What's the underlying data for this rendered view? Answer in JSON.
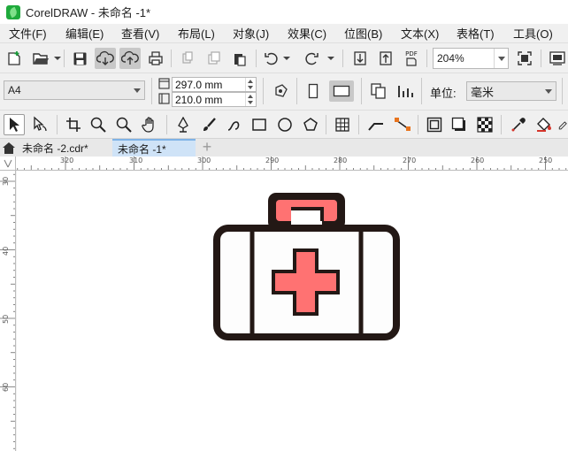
{
  "window": {
    "app_name": "CorelDRAW",
    "title": "CorelDRAW - 未命名 -1*"
  },
  "menu": [
    {
      "label": "文件(F)",
      "name": "menu-file"
    },
    {
      "label": "编辑(E)",
      "name": "menu-edit"
    },
    {
      "label": "查看(V)",
      "name": "menu-view"
    },
    {
      "label": "布局(L)",
      "name": "menu-layout"
    },
    {
      "label": "对象(J)",
      "name": "menu-object"
    },
    {
      "label": "效果(C)",
      "name": "menu-effects"
    },
    {
      "label": "位图(B)",
      "name": "menu-bitmaps"
    },
    {
      "label": "文本(X)",
      "name": "menu-text"
    },
    {
      "label": "表格(T)",
      "name": "menu-table"
    },
    {
      "label": "工具(O)",
      "name": "menu-tools"
    }
  ],
  "standard_toolbar": {
    "icons": [
      "new-document-icon",
      "open-icon",
      "save-icon",
      "cloud-download-icon",
      "cloud-upload-icon",
      "print-icon",
      "cut-icon",
      "copy-icon",
      "paste-icon",
      "undo-icon",
      "redo-icon",
      "import-icon",
      "export-icon",
      "publish-pdf-icon",
      "full-screen-icon",
      "options-icon"
    ],
    "pdf_label": "PDF",
    "zoom_level": "204%"
  },
  "property_bar": {
    "page_size": "A4",
    "page_width": "297.0 mm",
    "page_height": "210.0 mm",
    "units_label": "单位:",
    "units_value": "毫米"
  },
  "toolbox": {
    "icons": [
      "pick-tool-icon",
      "shape-tool-icon",
      "crop-tool-icon",
      "zoom-tool-icon",
      "zoom-out-tool-icon",
      "pan-tool-icon",
      "pen-tool-icon",
      "brush-tool-icon",
      "spiral-tool-icon",
      "rectangle-tool-icon",
      "ellipse-tool-icon",
      "polygon-tool-icon",
      "table-tool-icon",
      "connector-tool-icon",
      "dimension-tool-icon",
      "frame-icon",
      "drop-shadow-icon",
      "transparency-icon",
      "eyedropper-icon",
      "fill-icon"
    ]
  },
  "document_tabs": [
    {
      "label": "未命名 -2.cdr*",
      "active": false
    },
    {
      "label": "未命名 -1*",
      "active": true
    }
  ],
  "rulers": {
    "horizontal_labels": [
      "320",
      "310",
      "300",
      "290",
      "280",
      "270",
      "260",
      "250"
    ],
    "vertical_labels": [
      "30",
      "40",
      "50",
      "60"
    ]
  },
  "artwork": {
    "subject": "first-aid-kit",
    "outline_color": "#231815",
    "body_color": "#fdfdfd",
    "cross_color": "#ff7272",
    "handle_color": "#ff7272"
  },
  "colors": {
    "title_bg": "#ffffff",
    "ui_bg": "#f0f0f0",
    "active_tab": "#cfe3f7",
    "canvas": "#ffffff"
  }
}
